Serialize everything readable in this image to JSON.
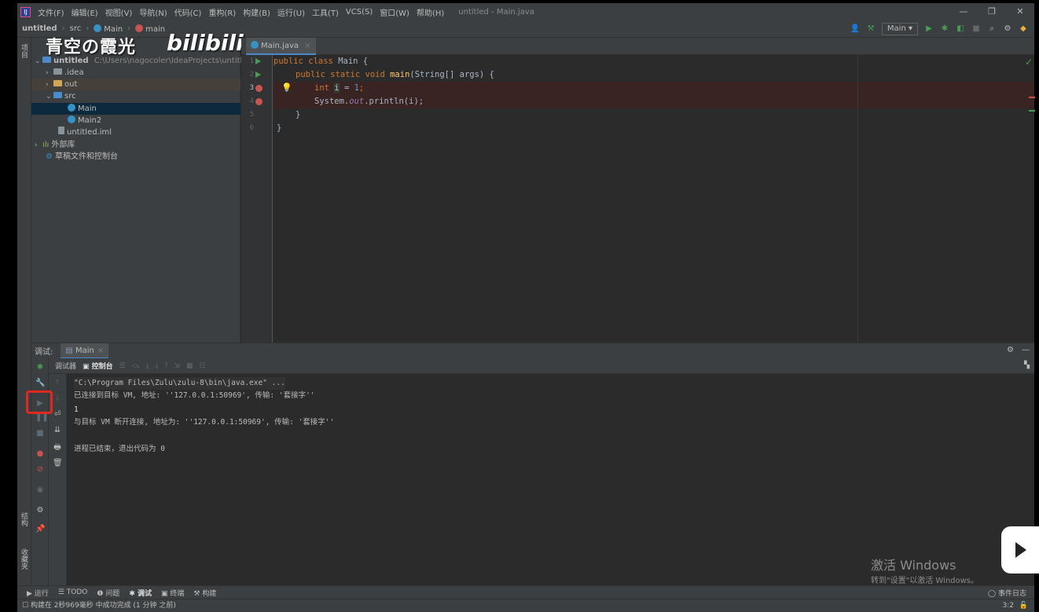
{
  "menu": {
    "items": [
      "文件(F)",
      "编辑(E)",
      "视图(V)",
      "导航(N)",
      "代码(C)",
      "重构(R)",
      "构建(B)",
      "运行(U)",
      "工具(T)",
      "VCS(S)",
      "窗口(W)",
      "帮助(H)"
    ],
    "window_title": "untitled - Main.java"
  },
  "nav": {
    "project": "untitled",
    "crumbs": [
      "src",
      "Main",
      "main"
    ],
    "run_config": "Main"
  },
  "watermark": {
    "text": "青空の霞光",
    "logo": "bilibili"
  },
  "project_panel": {
    "label": "项目",
    "root": {
      "name": "untitled",
      "path": "C:\\Users\\nagocoler\\IdeaProjects\\untitled"
    },
    "items": [
      {
        "label": ".idea",
        "kind": "folder"
      },
      {
        "label": "out",
        "kind": "folder-orange"
      },
      {
        "label": "src",
        "kind": "folder-blue"
      },
      {
        "label": "Main",
        "kind": "class"
      },
      {
        "label": "Main2",
        "kind": "class"
      },
      {
        "label": "untitled.iml",
        "kind": "file"
      },
      {
        "label": "外部库",
        "kind": "library"
      },
      {
        "label": "草稿文件和控制台",
        "kind": "scratch"
      }
    ]
  },
  "editor": {
    "tab": "Main.java",
    "line_numbers": [
      "1",
      "2",
      "3",
      "4",
      "5",
      "6"
    ],
    "code": {
      "l1_kw": "public class ",
      "l1_name": "Main",
      "l1_rest": " {",
      "l2_kw": "public static void ",
      "l2_fn": "main",
      "l2_rest": "(String[] args) {",
      "l3_kw": "int ",
      "l3_var": "i",
      "l3_eq": " = ",
      "l3_num": "1",
      "l3_end": ";",
      "l4_a": "System.",
      "l4_field": "out",
      "l4_b": ".println(i);",
      "l5": "}",
      "l6": "}"
    }
  },
  "debug": {
    "label": "调试:",
    "tab": "Main",
    "subtabs": [
      "调试器",
      "控制台"
    ],
    "console": [
      "\"C:\\Program Files\\Zulu\\zulu-8\\bin\\java.exe\" ...",
      "已连接到目标 VM, 地址: ''127.0.0.1:50969', 传输: '套接字''",
      "1",
      "与目标 VM 断开连接, 地址为: ''127.0.0.1:50969', 传输: '套接字''",
      "",
      "进程已结束，退出代码为 0"
    ]
  },
  "side_labels": {
    "structure": "结构",
    "favorites": "收藏夹"
  },
  "status_strip": [
    "运行",
    "TODO",
    "问题",
    "调试",
    "终端",
    "构建"
  ],
  "event_log": "事件日志",
  "status": {
    "message": "构建在 2秒969毫秒 中成功完成 (1 分钟 之前)",
    "position": "3:2"
  },
  "windows_activation": {
    "title": "激活 Windows",
    "subtitle": "转到\"设置\"以激活 Windows。"
  }
}
